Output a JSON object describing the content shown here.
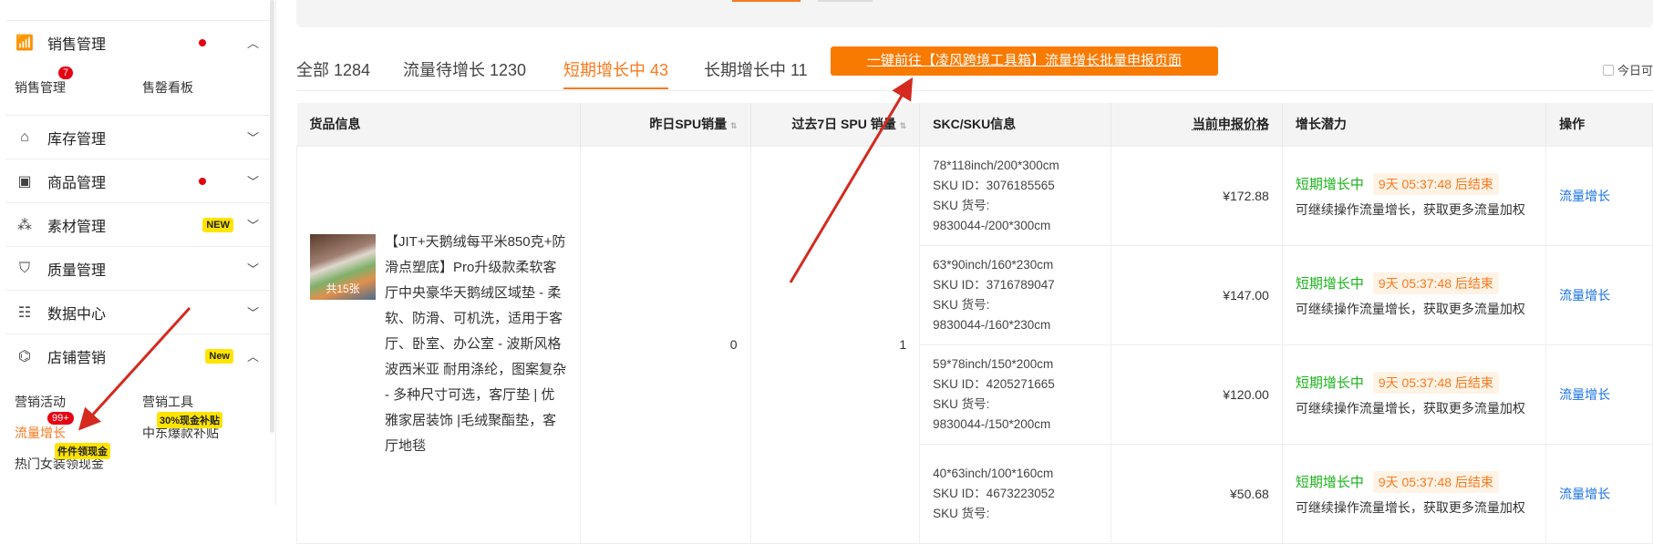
{
  "sidebar": {
    "groups": [
      {
        "label": "销售管理",
        "icon": "chart-icon",
        "dot": true,
        "expanded": true
      },
      {
        "label": "库存管理",
        "icon": "warehouse-icon"
      },
      {
        "label": "商品管理",
        "icon": "box-icon",
        "dot": true
      },
      {
        "label": "素材管理",
        "icon": "shapes-icon",
        "tag": "NEW"
      },
      {
        "label": "质量管理",
        "icon": "shield-icon"
      },
      {
        "label": "数据中心",
        "icon": "data-icon"
      },
      {
        "label": "店铺营销",
        "icon": "tag-icon",
        "tag": "New",
        "expanded": true
      }
    ],
    "sales_sub": [
      {
        "label": "销售管理",
        "badge": "7"
      },
      {
        "label": "售罄看板"
      }
    ],
    "marketing_sub": [
      {
        "label": "营销活动"
      },
      {
        "label": "营销工具"
      },
      {
        "label": "流量增长",
        "badge": "99+"
      },
      {
        "label": "中东爆款补贴",
        "tag": "30%现金补贴"
      },
      {
        "label": "热门女装领现金",
        "tag": "件件领现金"
      }
    ]
  },
  "tabs": [
    {
      "label": "全部 1284"
    },
    {
      "label": "流量待增长 1230"
    },
    {
      "label": "短期增长中 43",
      "active": true
    },
    {
      "label": "长期增长中 11"
    }
  ],
  "promo_button": "一键前往【凌风跨境工具箱】流量增长批量申报页面",
  "today_label": "今日可",
  "table": {
    "headers": [
      "货品信息",
      "昨日SPU销量",
      "过去7日 SPU 销量",
      "SKC/SKU信息",
      "当前申报价格",
      "增长潜力",
      "操作"
    ],
    "product": {
      "title": "【JIT+天鹅绒每平米850克+防滑点塑底】Pro升级款柔软客厅中央豪华天鹅绒区域垫 - 柔软、防滑、可机洗，适用于客厅、卧室、办公室 - 波斯风格波西米亚 耐用涤纶，图案复杂 - 多种尺寸可选，客厅垫 | 优雅家居装饰 |毛绒聚酯垫，客厅地毯",
      "image_count": "共15张",
      "yesterday": "0",
      "last7": "1"
    },
    "rows": [
      {
        "size": "78*118inch/200*300cm",
        "sku_id": "SKU ID：3076185565",
        "sku_no_label": "SKU 货号:",
        "sku_no": "9830044-/200*300cm",
        "price": "¥172.88",
        "status": "短期增长中",
        "countdown": "9天 05:37:48 后结束",
        "tip": "可继续操作流量增长，获取更多流量加权",
        "action": "流量增长"
      },
      {
        "size": "63*90inch/160*230cm",
        "sku_id": "SKU ID：3716789047",
        "sku_no_label": "SKU 货号:",
        "sku_no": "9830044-/160*230cm",
        "price": "¥147.00",
        "status": "短期增长中",
        "countdown": "9天 05:37:48 后结束",
        "tip": "可继续操作流量增长，获取更多流量加权",
        "action": "流量增长"
      },
      {
        "size": "59*78inch/150*200cm",
        "sku_id": "SKU ID：4205271665",
        "sku_no_label": "SKU 货号:",
        "sku_no": "9830044-/150*200cm",
        "price": "¥120.00",
        "status": "短期增长中",
        "countdown": "9天 05:37:48 后结束",
        "tip": "可继续操作流量增长，获取更多流量加权",
        "action": "流量增长"
      },
      {
        "size": "40*63inch/100*160cm",
        "sku_id": "SKU ID：4673223052",
        "sku_no_label": "SKU 货号:",
        "sku_no": "",
        "price": "¥50.68",
        "status": "短期增长中",
        "countdown": "9天 05:37:48 后结束",
        "tip": "可继续操作流量增长，获取更多流量加权",
        "action": "流量增长"
      }
    ]
  },
  "colors": {
    "accent": "#f97a1d",
    "green": "#19b319",
    "link": "#1a73e8",
    "arrow": "#d42a1f"
  }
}
